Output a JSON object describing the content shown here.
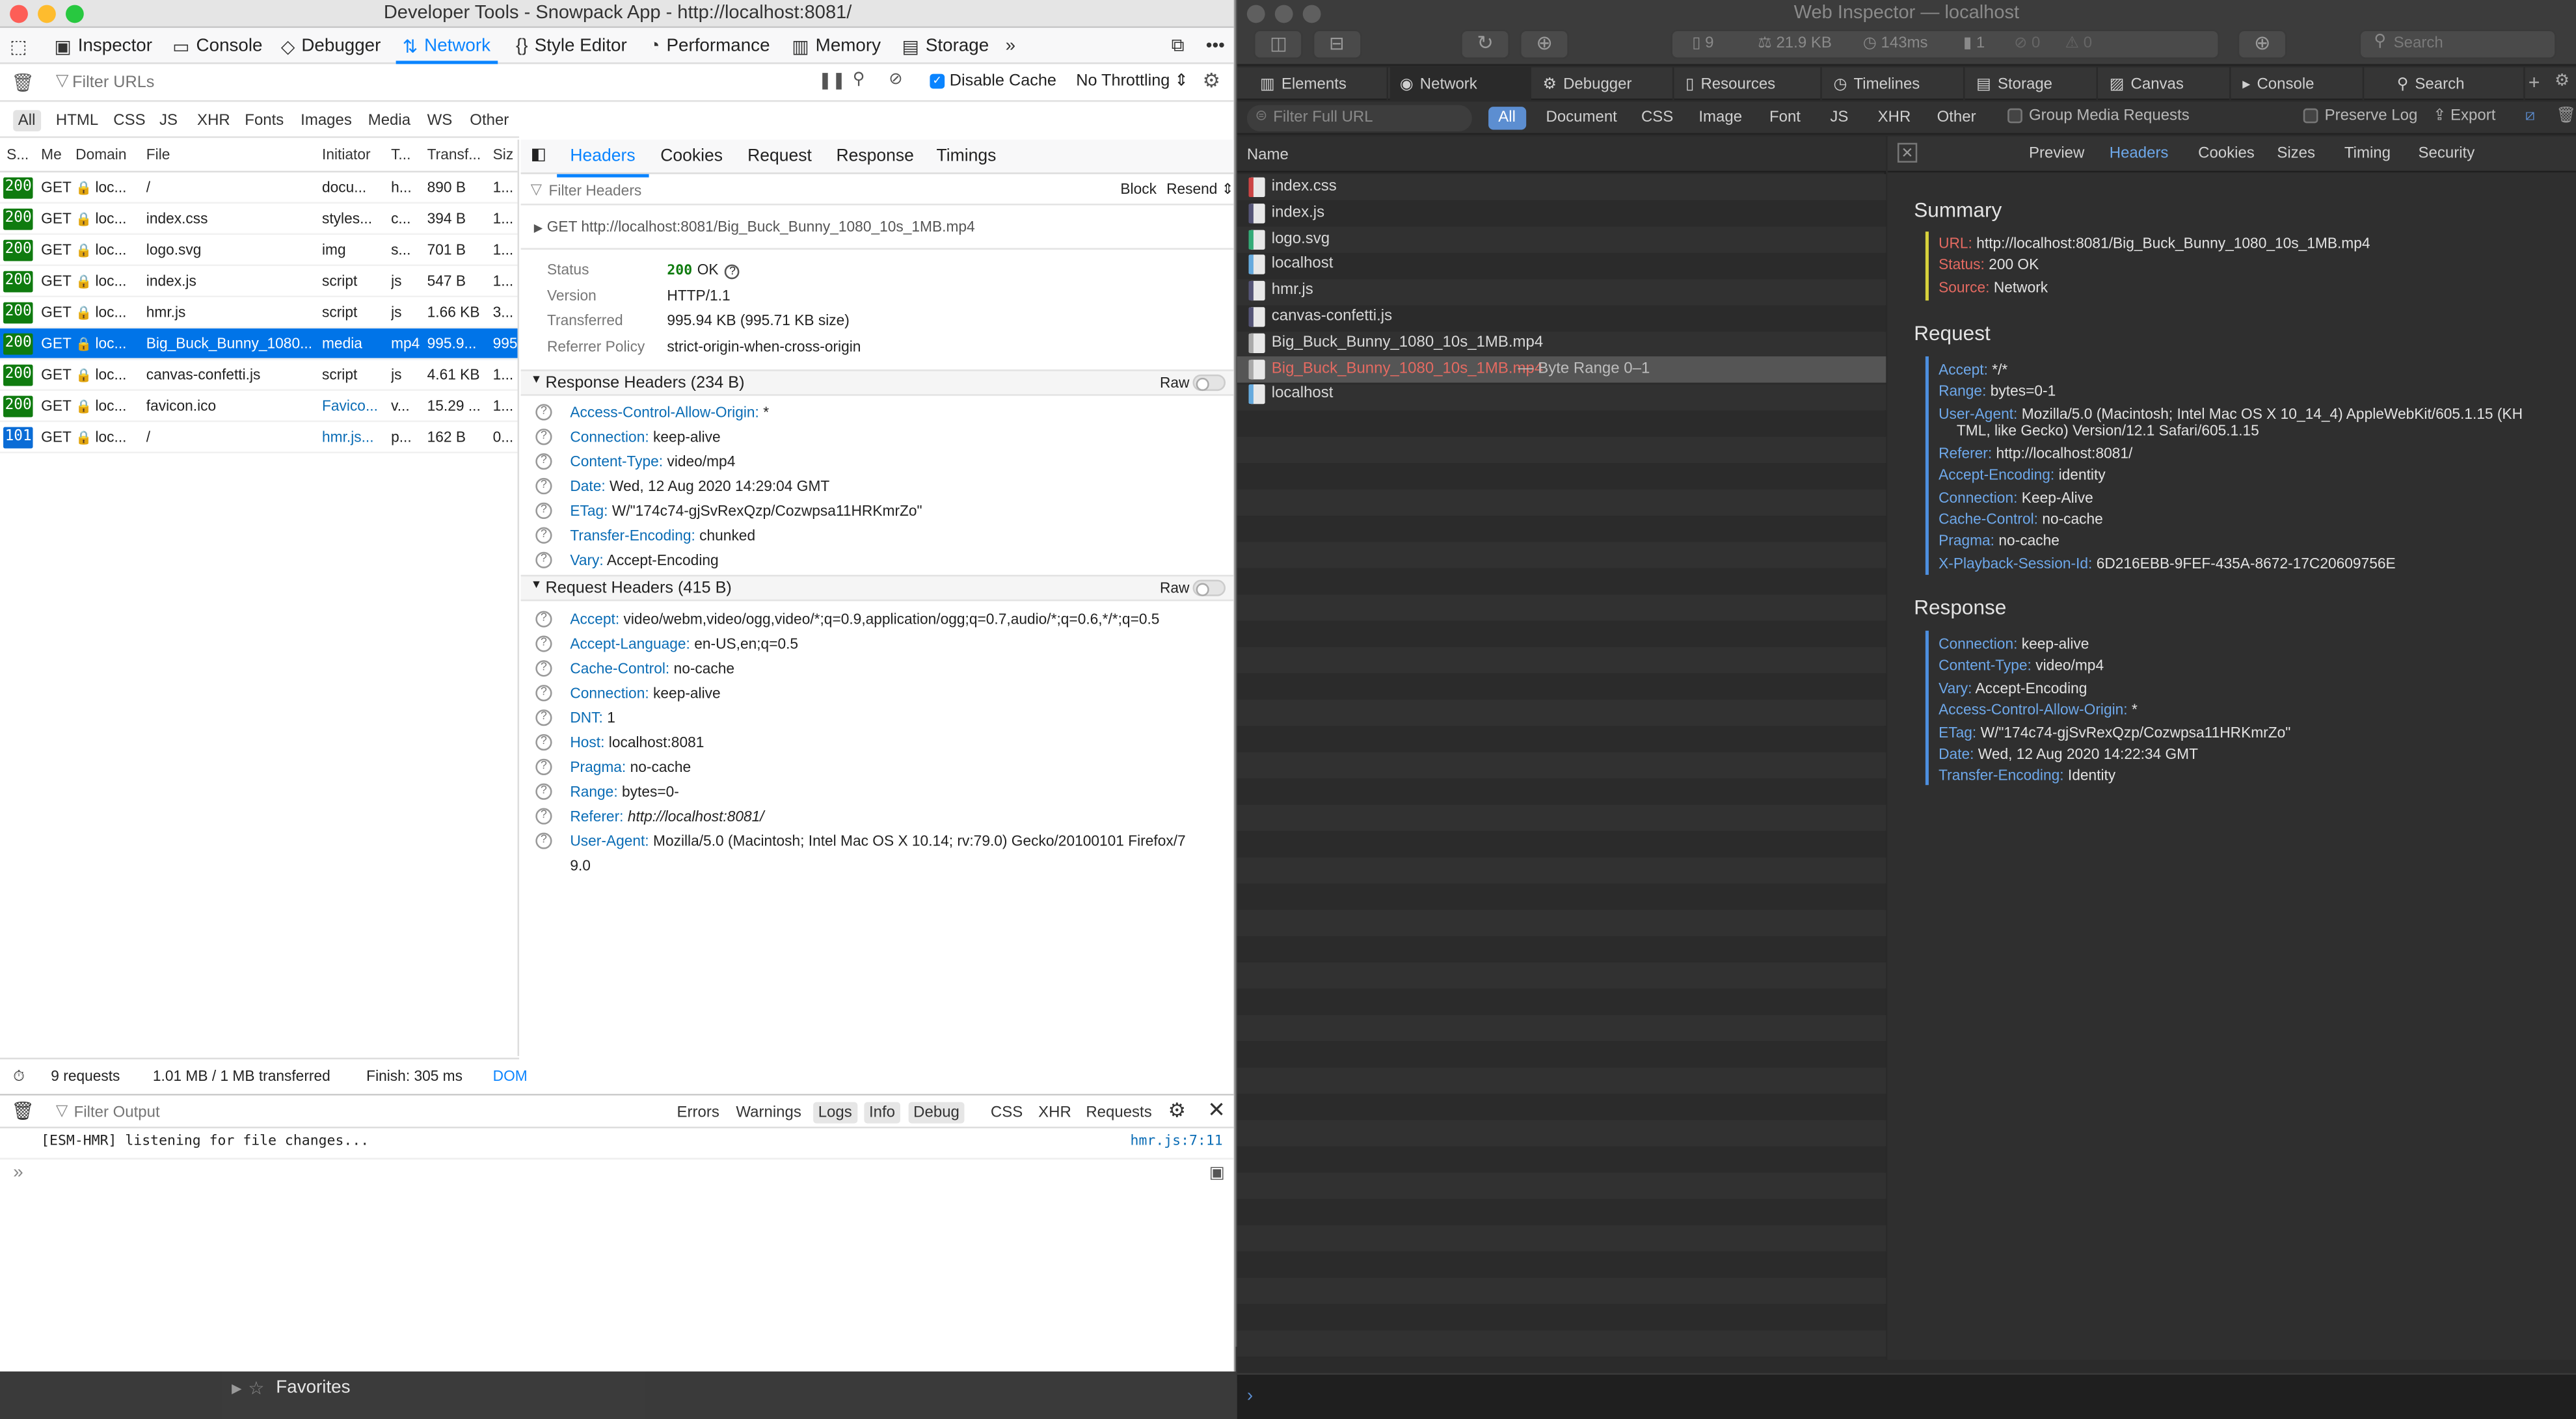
{
  "finder": {
    "label": "Favorites"
  },
  "firefox": {
    "title": "Developer Tools - Snowpack App - http://localhost:8081/",
    "tabs": [
      "Inspector",
      "Console",
      "Debugger",
      "Network",
      "Style Editor",
      "Performance",
      "Memory",
      "Storage"
    ],
    "filter_placeholder": "Filter URLs",
    "disable_cache": "Disable Cache",
    "throttling": "No Throttling",
    "type_filters": [
      "All",
      "HTML",
      "CSS",
      "JS",
      "XHR",
      "Fonts",
      "Images",
      "Media",
      "WS",
      "Other"
    ],
    "columns": [
      "S...",
      "Me",
      "Domain",
      "File",
      "Initiator",
      "T...",
      "Transf...",
      "Siz"
    ],
    "requests": [
      {
        "status": "200",
        "method": "GET",
        "domain": "loc...",
        "file": "/",
        "initiator": "docu...",
        "type": "h...",
        "transferred": "890 B",
        "size": "1..."
      },
      {
        "status": "200",
        "method": "GET",
        "domain": "loc...",
        "file": "index.css",
        "initiator": "styles...",
        "type": "c...",
        "transferred": "394 B",
        "size": "1..."
      },
      {
        "status": "200",
        "method": "GET",
        "domain": "loc...",
        "file": "logo.svg",
        "initiator": "img",
        "type": "s...",
        "transferred": "701 B",
        "size": "1..."
      },
      {
        "status": "200",
        "method": "GET",
        "domain": "loc...",
        "file": "index.js",
        "initiator": "script",
        "type": "js",
        "transferred": "547 B",
        "size": "1..."
      },
      {
        "status": "200",
        "method": "GET",
        "domain": "loc...",
        "file": "hmr.js",
        "initiator": "script",
        "type": "js",
        "transferred": "1.66 KB",
        "size": "3..."
      },
      {
        "status": "200",
        "method": "GET",
        "domain": "loc...",
        "file": "Big_Buck_Bunny_1080...",
        "initiator": "media",
        "type": "mp4",
        "transferred": "995.9...",
        "size": "995"
      },
      {
        "status": "200",
        "method": "GET",
        "domain": "loc...",
        "file": "canvas-confetti.js",
        "initiator": "script",
        "type": "js",
        "transferred": "4.61 KB",
        "size": "1..."
      },
      {
        "status": "200",
        "method": "GET",
        "domain": "loc...",
        "file": "favicon.ico",
        "initiator": "Favico...",
        "type": "v...",
        "transferred": "15.29 ...",
        "size": "1..."
      },
      {
        "status": "101",
        "method": "GET",
        "domain": "loc...",
        "file": "/",
        "initiator": "hmr.js...",
        "type": "p...",
        "transferred": "162 B",
        "size": "0..."
      }
    ],
    "status_bar": {
      "requests": "9 requests",
      "transferred": "1.01 MB / 1 MB transferred",
      "finish": "Finish: 305 ms",
      "dom": "DOM"
    },
    "detail_tabs": [
      "Headers",
      "Cookies",
      "Request",
      "Response",
      "Timings"
    ],
    "filter_headers": "Filter Headers",
    "block": "Block",
    "resend": "Resend",
    "get_url": "GET http://localhost:8081/Big_Buck_Bunny_1080_10s_1MB.mp4",
    "summary": [
      {
        "k": "Status",
        "v": "200 OK"
      },
      {
        "k": "Version",
        "v": "HTTP/1.1"
      },
      {
        "k": "Transferred",
        "v": "995.94 KB (995.71 KB size)"
      },
      {
        "k": "Referrer Policy",
        "v": "strict-origin-when-cross-origin"
      }
    ],
    "status_code": "200",
    "status_text": "OK",
    "response_headers_title": "Response Headers (234 B)",
    "response_headers": [
      {
        "k": "Access-Control-Allow-Origin:",
        "v": "*"
      },
      {
        "k": "Connection:",
        "v": "keep-alive"
      },
      {
        "k": "Content-Type:",
        "v": "video/mp4"
      },
      {
        "k": "Date:",
        "v": "Wed, 12 Aug 2020 14:29:04 GMT"
      },
      {
        "k": "ETag:",
        "v": "W/\"174c74-gjSvRexQzp/Cozwpsa11HRKmrZo\""
      },
      {
        "k": "Transfer-Encoding:",
        "v": "chunked"
      },
      {
        "k": "Vary:",
        "v": "Accept-Encoding"
      }
    ],
    "request_headers_title": "Request Headers (415 B)",
    "request_headers": [
      {
        "k": "Accept:",
        "v": "video/webm,video/ogg,video/*;q=0.9,application/ogg;q=0.7,audio/*;q=0.6,*/*;q=0.5"
      },
      {
        "k": "Accept-Language:",
        "v": "en-US,en;q=0.5"
      },
      {
        "k": "Cache-Control:",
        "v": "no-cache"
      },
      {
        "k": "Connection:",
        "v": "keep-alive"
      },
      {
        "k": "DNT:",
        "v": "1"
      },
      {
        "k": "Host:",
        "v": "localhost:8081"
      },
      {
        "k": "Pragma:",
        "v": "no-cache"
      },
      {
        "k": "Range:",
        "v": "bytes=0-"
      },
      {
        "k": "Referer:",
        "v": "http://localhost:8081/"
      },
      {
        "k": "User-Agent:",
        "v": "Mozilla/5.0 (Macintosh; Intel Mac OS X 10.14; rv:79.0) Gecko/20100101 Firefox/7"
      },
      {
        "k": "",
        "v": "9.0"
      }
    ],
    "raw": "Raw",
    "console": {
      "filter_placeholder": "Filter Output",
      "levels": [
        "Errors",
        "Warnings",
        "Logs",
        "Info",
        "Debug"
      ],
      "kinds": [
        "CSS",
        "XHR",
        "Requests"
      ],
      "message": "[ESM-HMR] listening for file changes...",
      "source": "hmr.js:7:11"
    }
  },
  "safari": {
    "title": "Web Inspector — localhost",
    "stats": {
      "resources": "9",
      "size": "21.9 KB",
      "time": "143ms",
      "errors": "1",
      "warnings": "0",
      "logs": "0"
    },
    "search_placeholder": "Search",
    "tabs": [
      "Elements",
      "Network",
      "Debugger",
      "Resources",
      "Timelines",
      "Storage",
      "Canvas",
      "Console",
      "Search"
    ],
    "filter_placeholder": "Filter Full URL",
    "types": [
      "All",
      "Document",
      "CSS",
      "Image",
      "Font",
      "JS",
      "XHR",
      "Other"
    ],
    "group_media": "Group Media Requests",
    "preserve_log": "Preserve Log",
    "export": "Export",
    "name_header": "Name",
    "files": [
      {
        "name": "index.css"
      },
      {
        "name": "index.js"
      },
      {
        "name": "logo.svg"
      },
      {
        "name": "localhost"
      },
      {
        "name": "hmr.js"
      },
      {
        "name": "canvas-confetti.js"
      },
      {
        "name": "Big_Buck_Bunny_1080_10s_1MB.mp4"
      },
      {
        "name": "Big_Buck_Bunny_1080_10s_1MB.mp4",
        "suffix": " — Byte Range 0–1"
      },
      {
        "name": "localhost"
      }
    ],
    "detail_tabs": [
      "Preview",
      "Headers",
      "Cookies",
      "Sizes",
      "Timing",
      "Security"
    ],
    "summary_title": "Summary",
    "summary": [
      {
        "k": "URL:",
        "v": "http://localhost:8081/Big_Buck_Bunny_1080_10s_1MB.mp4"
      },
      {
        "k": "Status:",
        "v": "200 OK"
      },
      {
        "k": "Source:",
        "v": "Network"
      }
    ],
    "request_title": "Request",
    "request": [
      {
        "k": "Accept:",
        "v": "*/*"
      },
      {
        "k": "Range:",
        "v": "bytes=0-1"
      },
      {
        "k": "User-Agent:",
        "v": "Mozilla/5.0 (Macintosh; Intel Mac OS X 10_14_4) AppleWebKit/605.1.15 (KH"
      },
      {
        "k": "",
        "v": "TML, like Gecko) Version/12.1 Safari/605.1.15"
      },
      {
        "k": "Referer:",
        "v": "http://localhost:8081/"
      },
      {
        "k": "Accept-Encoding:",
        "v": "identity"
      },
      {
        "k": "Connection:",
        "v": "Keep-Alive"
      },
      {
        "k": "Cache-Control:",
        "v": "no-cache"
      },
      {
        "k": "Pragma:",
        "v": "no-cache"
      },
      {
        "k": "X-Playback-Session-Id:",
        "v": "6D216EBB-9FEF-435A-8672-17C20609756E"
      }
    ],
    "response_title": "Response",
    "response": [
      {
        "k": "Connection:",
        "v": "keep-alive"
      },
      {
        "k": "Content-Type:",
        "v": "video/mp4"
      },
      {
        "k": "Vary:",
        "v": "Accept-Encoding"
      },
      {
        "k": "Access-Control-Allow-Origin:",
        "v": "*"
      },
      {
        "k": "ETag:",
        "v": "W/\"174c74-gjSvRexQzp/Cozwpsa11HRKmrZo\""
      },
      {
        "k": "Date:",
        "v": "Wed, 12 Aug 2020 14:22:34 GMT"
      },
      {
        "k": "Transfer-Encoding:",
        "v": "Identity"
      }
    ]
  },
  "colors": {
    "firefox_accent": "#0a84ff",
    "selected_row": "#0074e8",
    "status_ok": "#0f7b0f",
    "safari_key": "#6ea8ea",
    "safari_key_red": "#e46a61",
    "safari_selected_file": "#e46a61"
  }
}
